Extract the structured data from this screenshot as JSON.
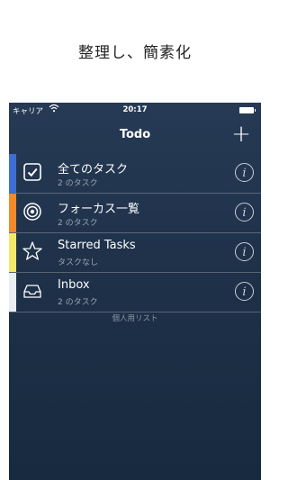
{
  "headline": "整理し、簡素化",
  "status": {
    "carrier": "キャリア",
    "time": "20:17"
  },
  "nav": {
    "title": "Todo",
    "add_glyph": "+"
  },
  "lists": [
    {
      "name": "全てのタスク",
      "subtitle": "2 のタスク",
      "color": "#3d6fd1",
      "icon": "checkbox-icon"
    },
    {
      "name": "フォーカス一覧",
      "subtitle": "2 のタスク",
      "color": "#f08a2a",
      "icon": "target-icon"
    },
    {
      "name": "Starred Tasks",
      "subtitle": "タスクなし",
      "color": "#f2e86a",
      "icon": "star-icon"
    },
    {
      "name": "Inbox",
      "subtitle": "2 のタスク",
      "color": "#e9eef3",
      "icon": "inbox-tray-icon"
    }
  ],
  "info_glyph": "i",
  "section_footer": "個人用リスト"
}
